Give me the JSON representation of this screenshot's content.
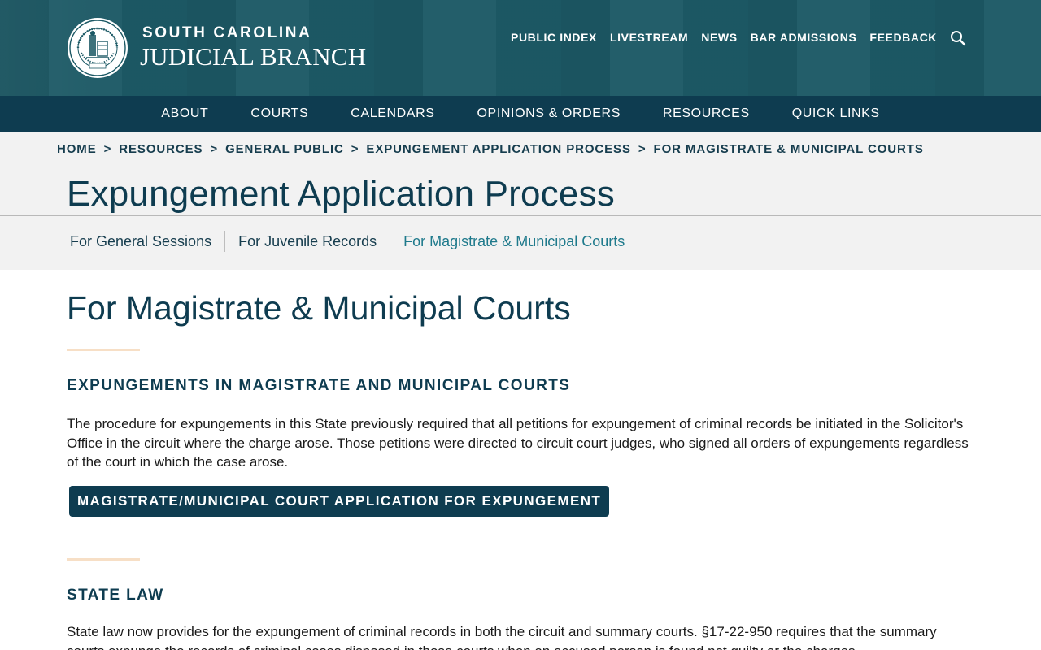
{
  "header": {
    "brand_line1": "SOUTH CAROLINA",
    "brand_line2": "JUDICIAL BRANCH",
    "logo_icon": "supreme-court-seal-icon",
    "utility_links": [
      "PUBLIC INDEX",
      "LIVESTREAM",
      "NEWS",
      "BAR ADMISSIONS",
      "FEEDBACK"
    ],
    "search_icon": "search-icon"
  },
  "main_nav": [
    "ABOUT",
    "COURTS",
    "CALENDARS",
    "OPINIONS & ORDERS",
    "RESOURCES",
    "QUICK LINKS"
  ],
  "breadcrumb": {
    "items": [
      "HOME",
      "RESOURCES",
      "GENERAL PUBLIC",
      "EXPUNGEMENT APPLICATION PROCESS",
      "FOR MAGISTRATE & MUNICIPAL COURTS"
    ],
    "separator": ">"
  },
  "page_title": "Expungement Application Process",
  "subnav": {
    "items": [
      "For General Sessions",
      "For Juvenile Records",
      "For Magistrate & Municipal Courts"
    ],
    "active_index": 2
  },
  "content": {
    "heading": "For Magistrate & Municipal Courts",
    "section1_title": "EXPUNGEMENTS IN MAGISTRATE AND MUNICIPAL COURTS",
    "section1_body": "The procedure for expungements in this State previously required that all petitions for expungement of criminal records be initiated in the Solicitor's Office in the circuit where the charge arose. Those petitions were directed to circuit court judges, who signed all orders of expungements regardless of the court in which the case arose.",
    "cta_label": "MAGISTRATE/MUNICIPAL COURT APPLICATION FOR EXPUNGEMENT",
    "section2_title": "STATE LAW",
    "section2_body": "State law now provides for the expungement of criminal records in both the circuit and summary courts. §17-22-950 requires that the summary courts expunge the records of criminal cases disposed in those courts when an accused person is found not guilty or the charges"
  },
  "colors": {
    "header_bg": "#1c5965",
    "nav_bg": "#0e3c50",
    "band_bg": "#f2f2f2",
    "title_text": "#0e3c50",
    "active_link": "#1f7a8c",
    "accent_rule": "#f7dfc6"
  }
}
